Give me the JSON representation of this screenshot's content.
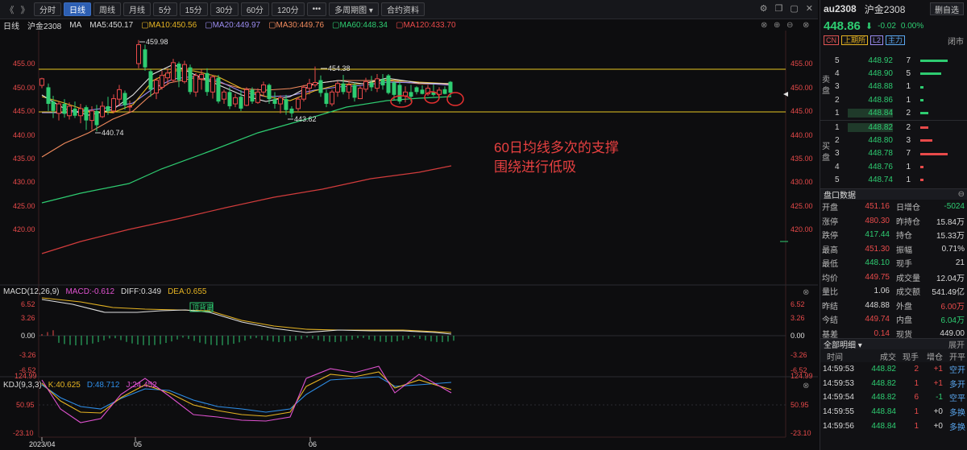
{
  "toolbar": {
    "nav_back": "《",
    "nav_fwd": "》",
    "buttons": [
      "分时",
      "日线",
      "周线",
      "月线",
      "5分",
      "15分",
      "30分",
      "60分",
      "120分",
      "•••",
      "多周期图 ▾",
      "合约资料"
    ],
    "active_index": 1
  },
  "main_legend": {
    "label": "日线",
    "symbol": "沪金2308",
    "ma": "MA",
    "ma5": "MA5:450.17",
    "ma10": "MA10:450.56",
    "ma20": "MA20:449.97",
    "ma30": "MA30:449.76",
    "ma60": "MA60:448.34",
    "ma120": "MA120:433.70"
  },
  "colors": {
    "up": "#e84a4a",
    "down": "#2ecc71",
    "ma5": "#e0e0e0",
    "ma10": "#e6b422",
    "ma20": "#9b8cf0",
    "ma30": "#f08a5d",
    "ma60": "#2ecc71",
    "ma120": "#e84a4a"
  },
  "price_axis": {
    "ticks": [
      "455.00",
      "450.00",
      "445.00",
      "440.00",
      "435.00",
      "430.00",
      "425.00",
      "420.00"
    ]
  },
  "candle_annotations": {
    "high1": "459.98",
    "low1": "440.74",
    "high2": "454.38",
    "low2": "443.62"
  },
  "annotation": {
    "line1": "60日均线多次的支撑",
    "line2": "围绕进行低吸"
  },
  "macd": {
    "title": "MACD(12,26,9)",
    "macd_val": "MACD:-0.612",
    "diff": "DIFF:0.349",
    "dea": "DEA:0.655",
    "signal_tag": "顶背离",
    "ticks": [
      "6.52",
      "3.26",
      "0.00",
      "-3.26",
      "-6.52"
    ]
  },
  "kdj": {
    "title": "KDJ(9,3,3)",
    "k": "K:40.625",
    "d": "D:48.712",
    "j": "J:24.452",
    "ticks": [
      "124.99",
      "50.95",
      "-23.10"
    ]
  },
  "x_axis": {
    "labels": [
      "2023/04",
      "05",
      "06"
    ]
  },
  "right_panel": {
    "symbol": "au2308",
    "name": "沪金2308",
    "add_button": "删自选",
    "last_price": "448.86",
    "arrow": "⬇",
    "change": "-0.02",
    "change_pct": "0.00%",
    "tags": [
      "CN",
      "上期所",
      "L2",
      "主力"
    ],
    "status": "闭市",
    "sell_label": "卖盘",
    "buy_label": "买盘",
    "asks": [
      {
        "level": "5",
        "price": "448.92",
        "vol": "7",
        "bar": 1.0
      },
      {
        "level": "4",
        "price": "448.90",
        "vol": "5",
        "bar": 0.75
      },
      {
        "level": "3",
        "price": "448.88",
        "vol": "1",
        "bar": 0.12
      },
      {
        "level": "2",
        "price": "448.86",
        "vol": "1",
        "bar": 0.12
      },
      {
        "level": "1",
        "price": "448.84",
        "vol": "2",
        "bar": 0.3
      }
    ],
    "bids": [
      {
        "level": "1",
        "price": "448.82",
        "vol": "2",
        "bar": 0.3
      },
      {
        "level": "2",
        "price": "448.80",
        "vol": "3",
        "bar": 0.45
      },
      {
        "level": "3",
        "price": "448.78",
        "vol": "7",
        "bar": 1.0
      },
      {
        "level": "4",
        "price": "448.76",
        "vol": "1",
        "bar": 0.12
      },
      {
        "level": "5",
        "price": "448.74",
        "vol": "1",
        "bar": 0.12
      }
    ],
    "stats_title": "盘口数据",
    "stats": [
      {
        "k": "开盘",
        "v": "451.16",
        "vc": "red",
        "k2": "日增仓",
        "v2": "-5024",
        "v2c": "green"
      },
      {
        "k": "涨停",
        "v": "480.30",
        "vc": "red",
        "k2": "昨持仓",
        "v2": "15.84万",
        "v2c": "white"
      },
      {
        "k": "跌停",
        "v": "417.44",
        "vc": "green",
        "k2": "持仓",
        "v2": "15.33万",
        "v2c": "white"
      },
      {
        "k": "最高",
        "v": "451.30",
        "vc": "red",
        "k2": "振幅",
        "v2": "0.71%",
        "v2c": "white"
      },
      {
        "k": "最低",
        "v": "448.10",
        "vc": "green",
        "k2": "现手",
        "v2": "21",
        "v2c": "white"
      },
      {
        "k": "均价",
        "v": "449.75",
        "vc": "red",
        "k2": "成交量",
        "v2": "12.04万",
        "v2c": "white"
      },
      {
        "k": "量比",
        "v": "1.06",
        "vc": "white",
        "k2": "成交额",
        "v2": "541.49亿",
        "v2c": "white"
      },
      {
        "k": "昨结",
        "v": "448.88",
        "vc": "white",
        "k2": "外盘",
        "v2": "6.00万",
        "v2c": "red"
      },
      {
        "k": "今结",
        "v": "449.74",
        "vc": "red",
        "k2": "内盘",
        "v2": "6.04万",
        "v2c": "green"
      },
      {
        "k": "基差",
        "v": "0.14",
        "vc": "red",
        "k2": "现货",
        "v2": "449.00",
        "v2c": "white"
      }
    ],
    "trades_title": "全部明细",
    "trades_expand": "展开",
    "trades_headers": [
      "时间",
      "成交",
      "现手",
      "增仓",
      "开平"
    ],
    "trades": [
      {
        "time": "14:59:53",
        "price": "448.82",
        "qty": "2",
        "oi": "+1",
        "dir": "空开",
        "pc": "green",
        "oic": "red",
        "dc": "blue"
      },
      {
        "time": "14:59:53",
        "price": "448.82",
        "qty": "1",
        "oi": "+1",
        "dir": "多开",
        "pc": "green",
        "oic": "red",
        "dc": "blue"
      },
      {
        "time": "14:59:54",
        "price": "448.82",
        "qty": "6",
        "oi": "-1",
        "dir": "空平",
        "pc": "green",
        "oic": "green",
        "dc": "blue"
      },
      {
        "time": "14:59:55",
        "price": "448.84",
        "qty": "1",
        "oi": "+0",
        "dir": "多换",
        "pc": "green",
        "oic": "white",
        "dc": "blue"
      },
      {
        "time": "14:59:56",
        "price": "448.84",
        "qty": "1",
        "oi": "+0",
        "dir": "多换",
        "pc": "green",
        "oic": "white",
        "dc": "blue"
      }
    ]
  }
}
